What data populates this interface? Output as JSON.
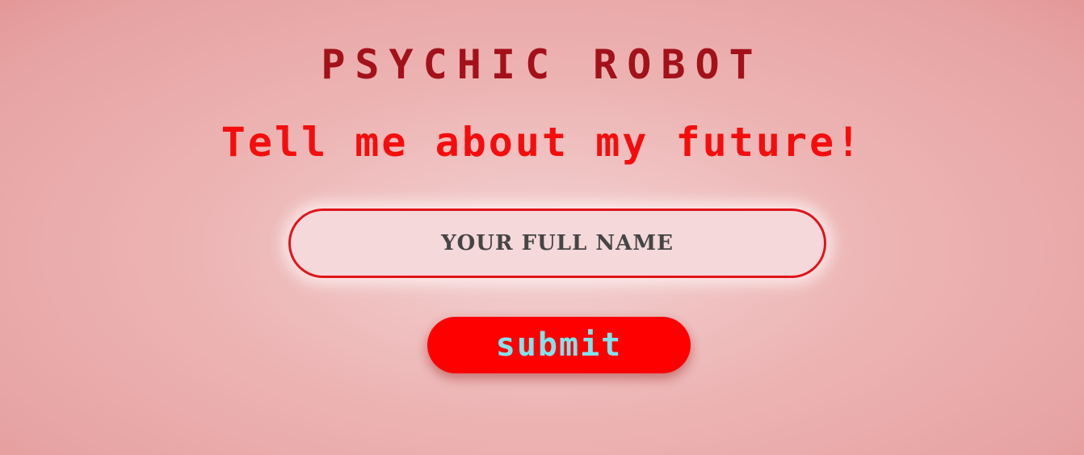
{
  "header": {
    "title": "PSYCHIC ROBOT",
    "subtitle": "Tell me about my future!"
  },
  "form": {
    "name_input": {
      "placeholder": "YOUR FULL NAME",
      "value": ""
    },
    "submit_label": "submit"
  },
  "colors": {
    "title": "#a3111a",
    "subtitle": "#f50d0d",
    "input_border": "#e0141a",
    "button_background": "#ff0000",
    "button_text": "#7fe3ee"
  }
}
